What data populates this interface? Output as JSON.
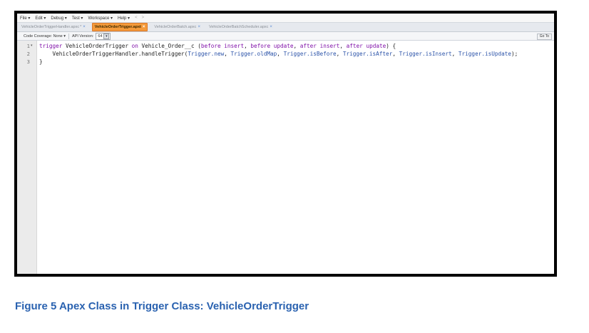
{
  "menu": [
    "File ▾",
    "Edit ▾",
    "Debug ▾",
    "Test ▾",
    "Workspace ▾",
    "Help ▾"
  ],
  "nav": {
    "back": "<",
    "forward": ">"
  },
  "tabs": [
    {
      "label": "VehicleOrderTriggerHandler.apxc",
      "modified": "*",
      "active": false
    },
    {
      "label": "VehicleOrderTrigger.apxt",
      "modified": "",
      "active": true
    },
    {
      "label": "VehicleOrderBatch.apxc",
      "modified": "",
      "active": false
    },
    {
      "label": "VehicleOrderBatchScheduler.apxc",
      "modified": "",
      "active": false
    }
  ],
  "tab_close": "×",
  "toolbar": {
    "coverage": "Code Coverage: None ▾",
    "api_label": "API Version:",
    "api_value": "64",
    "goto": "Go To"
  },
  "editor": {
    "line_numbers": [
      "1",
      "2",
      "3"
    ],
    "fold_marker": "▾",
    "lines": [
      "trigger VehicleOrderTrigger on Vehicle_Order__c (before insert, before update, after insert, after update) {",
      "    VehicleOrderTriggerHandler.handleTrigger(Trigger.new, Trigger.oldMap, Trigger.isBefore, Trigger.isAfter, Trigger.isInsert, Trigger.isUpdate);",
      "}"
    ]
  },
  "caption": "Figure 5  Apex Class in Trigger Class: VehicleOrderTrigger",
  "colors": {
    "active_tab": "#f49a3a",
    "keyword": "#7f0fa8",
    "trigger_ref": "#2a52a8",
    "caption": "#2a62b0"
  }
}
